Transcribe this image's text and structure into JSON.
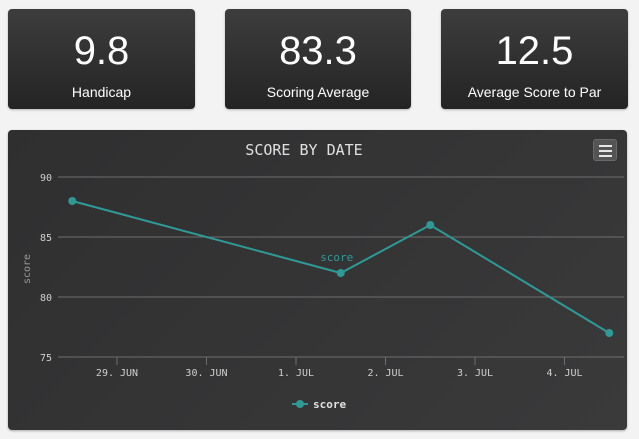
{
  "stats": [
    {
      "value": "9.8",
      "label": "Handicap"
    },
    {
      "value": "83.3",
      "label": "Scoring Average"
    },
    {
      "value": "12.5",
      "label": "Average Score to Par"
    }
  ],
  "chart_menu_icon": "hamburger-icon",
  "colors": {
    "series": "#2f9a95",
    "grid": "#6e6e6e",
    "text": "#cfcfcf",
    "card": "#2e2e2e"
  },
  "chart_data": {
    "type": "line",
    "title": "SCORE BY DATE",
    "ylabel": "score",
    "xlabel": "",
    "ylim": [
      75,
      90
    ],
    "y_ticks": [
      "90",
      "85",
      "80",
      "75"
    ],
    "x_ticks": [
      "29. JUN",
      "30. JUN",
      "1. JUL",
      "2. JUL",
      "3. JUL",
      "4. JUL"
    ],
    "series": [
      {
        "name": "score",
        "points": [
          {
            "x": "2016-06-28T12:00",
            "y": 88
          },
          {
            "x": "2016-07-01T12:00",
            "y": 82
          },
          {
            "x": "2016-07-02T12:00",
            "y": 86
          },
          {
            "x": "2016-07-04T12:00",
            "y": 77
          }
        ]
      }
    ],
    "annotation": "score",
    "legend": "bottom-center",
    "grid": true
  }
}
